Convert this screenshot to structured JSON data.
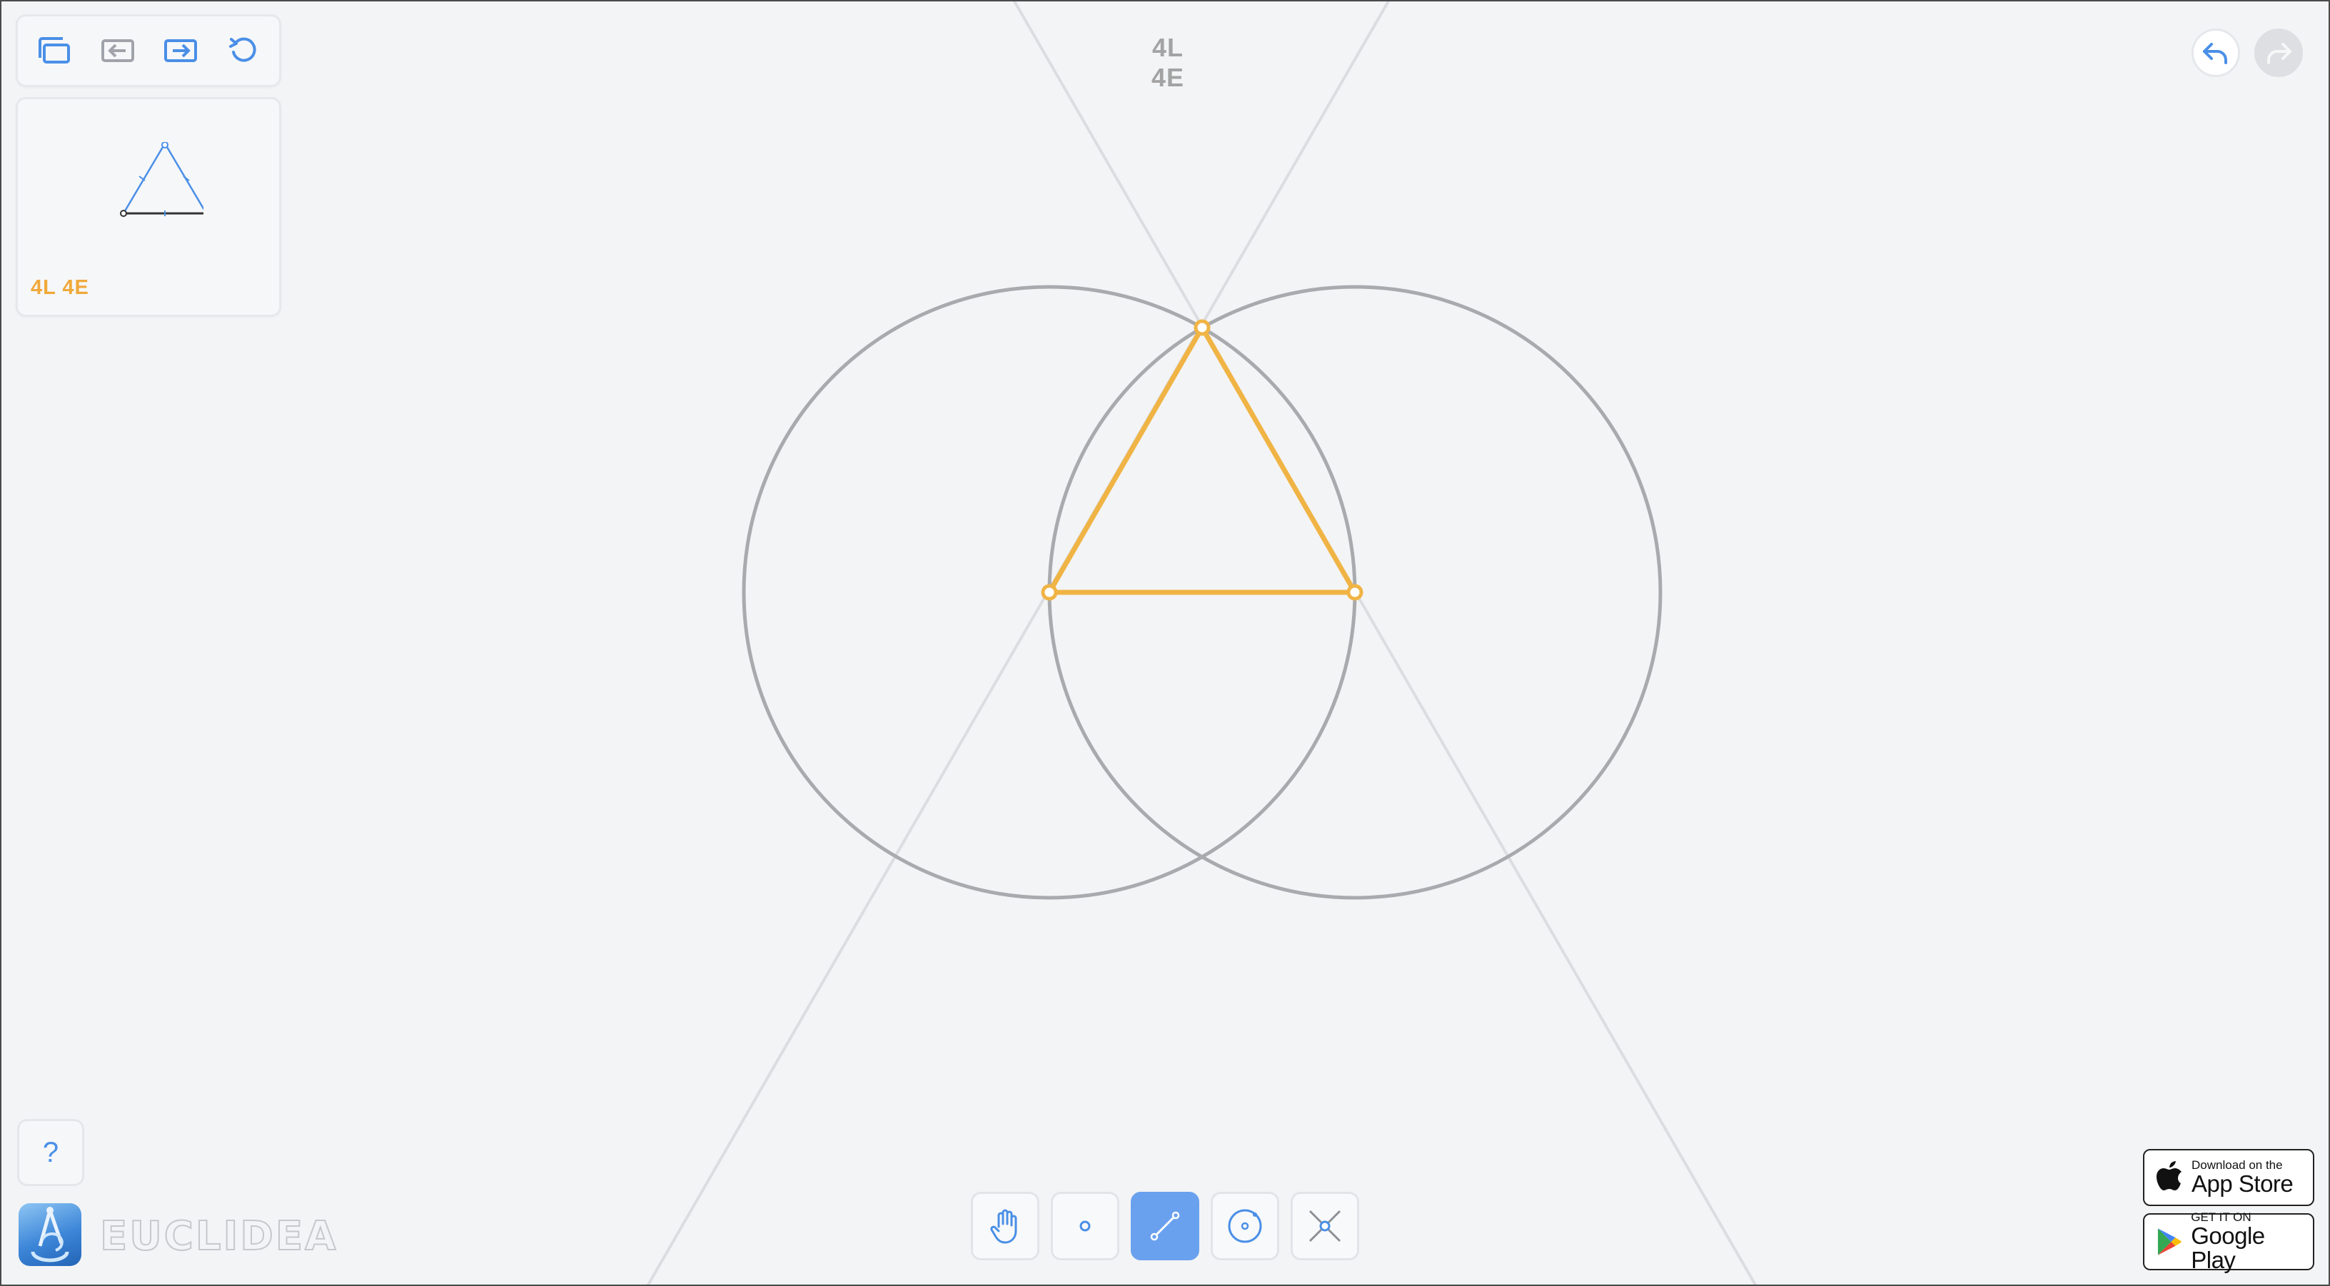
{
  "level": {
    "title": "4L 4E",
    "card_label": "4L 4E"
  },
  "top_toolbar": {
    "buttons": [
      {
        "name": "levels-icon"
      },
      {
        "name": "previous-level-icon"
      },
      {
        "name": "next-level-icon"
      },
      {
        "name": "restart-icon"
      }
    ]
  },
  "history": {
    "undo": "undo-icon",
    "redo": "redo-icon"
  },
  "help": {
    "label": "?"
  },
  "brand": {
    "name": "EUCLIDEA"
  },
  "tools": [
    {
      "name": "move-tool",
      "icon": "hand-icon",
      "active": false
    },
    {
      "name": "point-tool",
      "icon": "point-icon",
      "active": false
    },
    {
      "name": "line-tool",
      "icon": "line-icon",
      "active": true
    },
    {
      "name": "circle-tool",
      "icon": "circle-icon",
      "active": false
    },
    {
      "name": "intersect-tool",
      "icon": "intersect-icon",
      "active": false
    }
  ],
  "stores": {
    "app_store": {
      "small": "Download on the",
      "big": "App Store"
    },
    "google_play": {
      "small": "GET IT ON",
      "big": "Google Play"
    }
  },
  "colors": {
    "accent": "#f0a93a",
    "tool_blue": "#4a8fe7",
    "circle_stroke": "#a9aaad",
    "guide_line": "#dcdde0",
    "background": "#f3f4f6"
  }
}
